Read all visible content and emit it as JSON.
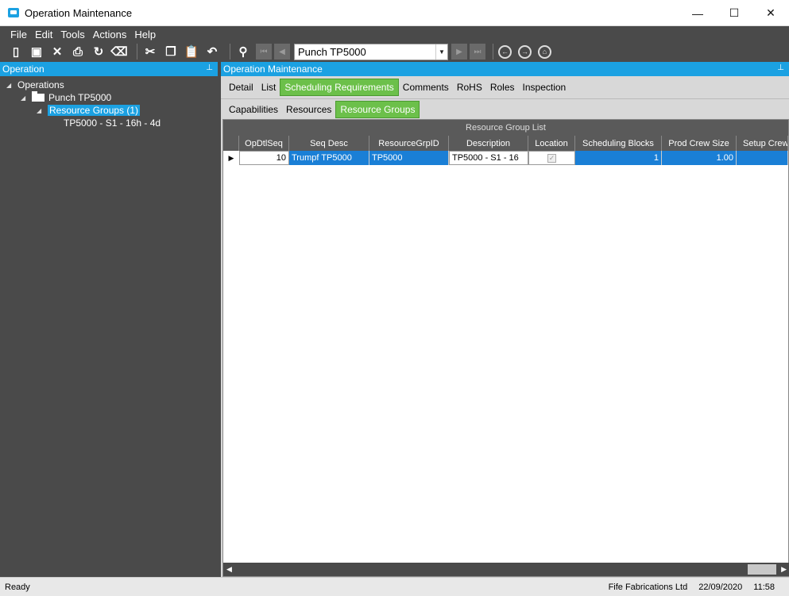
{
  "window": {
    "title": "Operation Maintenance",
    "controls": {
      "minimize": "—",
      "maximize": "☐",
      "close": "✕"
    }
  },
  "menu": [
    "File",
    "Edit",
    "Tools",
    "Actions",
    "Help"
  ],
  "toolbar": {
    "icons": [
      "new-icon",
      "save-icon",
      "delete-icon",
      "print-icon",
      "refresh-icon",
      "clear-icon",
      "cut-icon",
      "copy-icon",
      "paste-icon",
      "undo-icon",
      "search-icon"
    ],
    "record_combo": "Punch TP5000"
  },
  "left_panel": {
    "header": "Operation",
    "tree": [
      {
        "label": "Operations",
        "level": 0
      },
      {
        "label": "Punch TP5000",
        "level": 1
      },
      {
        "label": "Resource Groups (1)",
        "level": 2
      },
      {
        "label": "TP5000 - S1 - 16h - 4d",
        "level": 3
      }
    ]
  },
  "right_panel": {
    "header": "Operation Maintenance",
    "tabs": [
      "Detail",
      "List",
      "Scheduling Requirements",
      "Comments",
      "RoHS",
      "Roles",
      "Inspection"
    ],
    "active_tab": "Scheduling Requirements",
    "subtabs": [
      "Capabilities",
      "Resources",
      "Resource Groups"
    ],
    "active_subtab": "Resource Groups",
    "grid": {
      "caption": "Resource Group List",
      "columns": [
        "OpDtlSeq",
        "Seq Desc",
        "ResourceGrpID",
        "Description",
        "Location",
        "Scheduling Blocks",
        "Prod Crew Size",
        "Setup Crew"
      ],
      "rows": [
        {
          "OpDtlSeq": "10",
          "SeqDesc": "Trumpf TP5000",
          "ResourceGrpID": "TP5000",
          "Description": "TP5000 - S1 - 16",
          "Location": true,
          "SchedulingBlocks": "1",
          "ProdCrewSize": "1.00",
          "SetupCrew": ""
        }
      ]
    }
  },
  "statusbar": {
    "left": "Ready",
    "company": "Fife Fabrications Ltd",
    "date": "22/09/2020",
    "time": "11:58"
  },
  "colors": {
    "accent_blue": "#1ba1e2",
    "active_tab_green": "#6cc04a",
    "selection_blue": "#1a7fd6",
    "panel_dark": "#4a4a4a"
  }
}
